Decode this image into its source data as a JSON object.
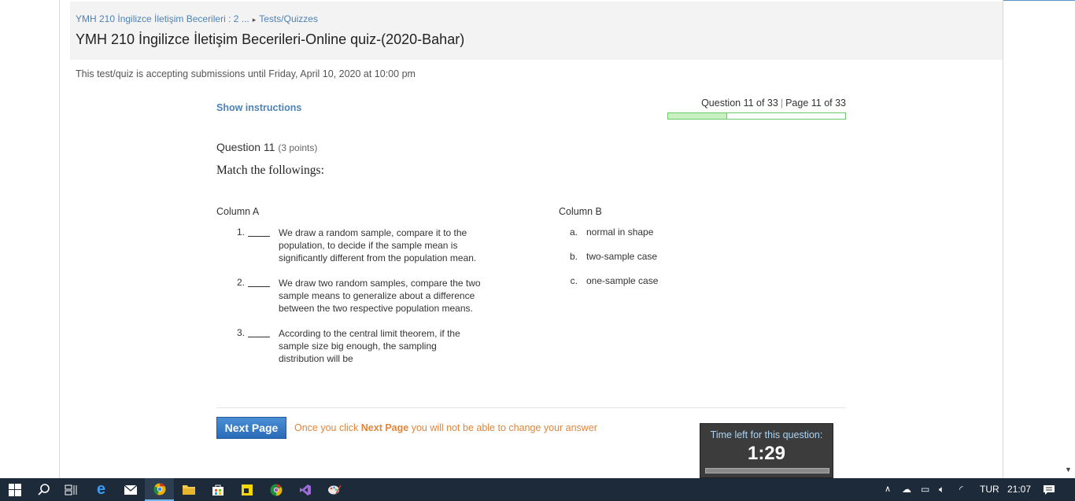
{
  "breadcrumb": {
    "course": "YMH 210 İngilizce İletişim Becerileri : 2 ...",
    "separator": "▸",
    "section": "Tests/Quizzes"
  },
  "page_title": "YMH 210 İngilizce İletişim Becerileri-Online quiz-(2020-Bahar)",
  "submission_note": "This test/quiz is accepting submissions until Friday, April 10, 2020 at 10:00 pm",
  "show_instructions": "Show instructions",
  "question_counter": {
    "question": "Question 11 of 33",
    "separator": "|",
    "page": "Page 11 of 33",
    "progress_fraction": 0.333
  },
  "question": {
    "title": "Question 11",
    "points": "(3 points)",
    "text": "Match the followings:",
    "column_a_header": "Column A",
    "column_b_header": "Column B",
    "column_a": [
      {
        "num": "1.",
        "text": "We draw a random sample, compare it to the population, to decide if the sample mean is significantly different from the population mean."
      },
      {
        "num": "2.",
        "text": "We draw two random samples, compare the two sample means to generalize about a difference between the two respective population means."
      },
      {
        "num": "3.",
        "text": "According to the central limit theorem, if the sample size big enough, the sampling distribution will be"
      }
    ],
    "column_b": [
      {
        "letter": "a.",
        "text": "normal in shape"
      },
      {
        "letter": "b.",
        "text": "two-sample case"
      },
      {
        "letter": "c.",
        "text": "one-sample case"
      }
    ]
  },
  "footer": {
    "next_button": "Next Page",
    "warning_before": "Once you click ",
    "warning_bold": "Next Page",
    "warning_after": " you will not be able to change your answer"
  },
  "timer": {
    "label": "Time left for this question:",
    "value": "1:29"
  },
  "taskbar": {
    "icons": [
      "windows-start",
      "search",
      "task-view",
      "edge",
      "mail",
      "chrome",
      "file-explorer",
      "store",
      "sticky-notes",
      "chrome-alt",
      "visual-studio",
      "paint"
    ],
    "language": "TUR",
    "clock": "21:07"
  },
  "colors": {
    "link": "#4e82b6",
    "warning": "#e0853a",
    "button": "#2a6bb8",
    "progress": "#6cc86c",
    "taskbar": "#1d2a3a"
  }
}
